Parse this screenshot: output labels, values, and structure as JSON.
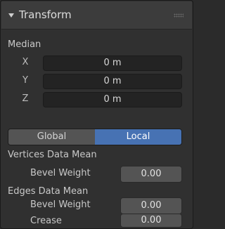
{
  "panel": {
    "title": "Transform"
  },
  "median": {
    "label": "Median",
    "rows": [
      {
        "axis": "X",
        "value": "0 m"
      },
      {
        "axis": "Y",
        "value": "0 m"
      },
      {
        "axis": "Z",
        "value": "0 m"
      }
    ]
  },
  "space_toggle": {
    "options": [
      "Global",
      "Local"
    ],
    "selected": "Local",
    "accent": "#4772b3"
  },
  "vertices": {
    "label": "Vertices Data Mean",
    "bevel_weight_label": "Bevel Weight",
    "bevel_weight_value": "0.00"
  },
  "edges": {
    "label": "Edges Data Mean",
    "bevel_weight_label": "Bevel Weight",
    "bevel_weight_value": "0.00",
    "crease_label": "Crease",
    "crease_value": "0.00"
  }
}
